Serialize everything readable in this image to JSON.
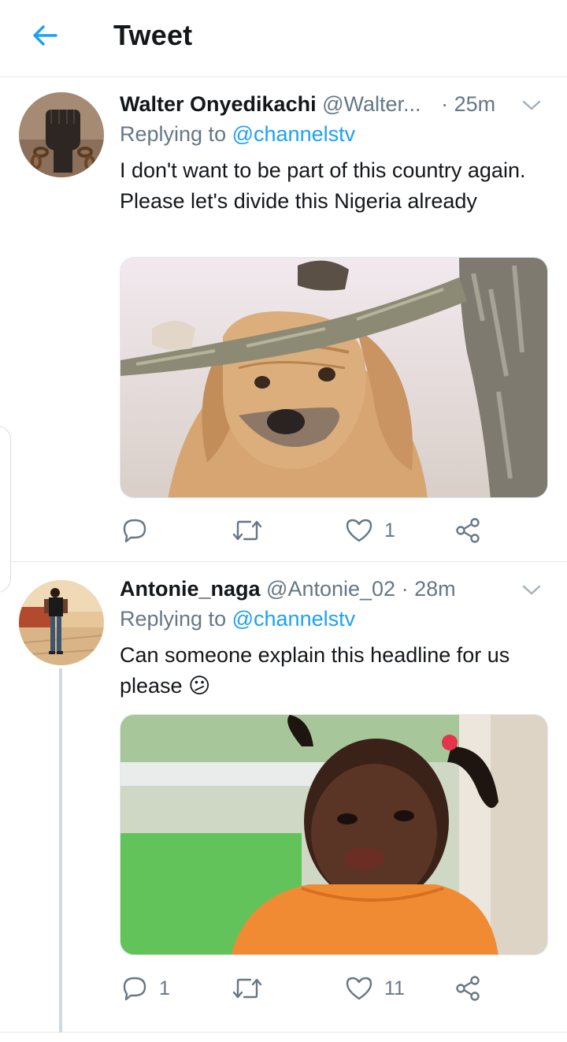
{
  "header": {
    "title": "Tweet",
    "back_icon": "arrow-left-icon",
    "accent": "#1da1f2"
  },
  "tweets": [
    {
      "name": "Walter Onyedikachi",
      "handle": "@Walter...",
      "separator": "·",
      "time": "25m",
      "reply_prefix": "Replying to",
      "reply_to": "@channelstv",
      "text": "I don't want to be part of this country again. Please let's divide this Nigeria already",
      "emoji": "",
      "media_description_icon": "dog-photo",
      "actions": {
        "reply": "",
        "retweet": "",
        "like": "1"
      }
    },
    {
      "name": "Antonie_naga",
      "handle": "@Antonie_02",
      "separator": "·",
      "time": "28m",
      "reply_prefix": "Replying to",
      "reply_to": "@channelstv",
      "text": "Can someone explain this headline for us please",
      "emoji": "😕",
      "media_description_icon": "child-photo",
      "actions": {
        "reply": "1",
        "retweet": "",
        "like": "11"
      }
    }
  ],
  "colors": {
    "text": "#14171a",
    "secondary": "#657786",
    "link": "#1da1f2",
    "divider": "#e1e8ed"
  }
}
